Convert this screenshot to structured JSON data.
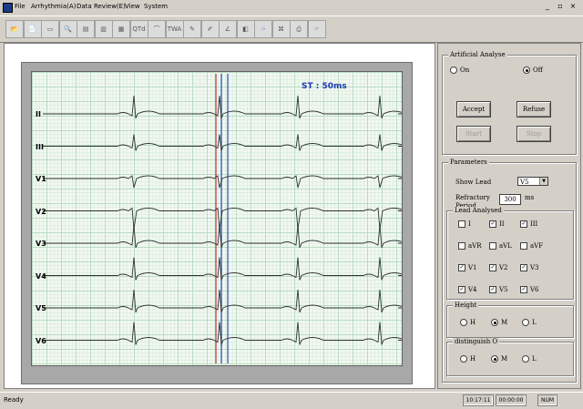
{
  "menu": [
    "File",
    "Arrhythmia(A)",
    "Data Review(E)",
    "View",
    "System"
  ],
  "window_buttons": [
    "_",
    "▫",
    "×"
  ],
  "toolbar": {
    "buttons": [
      {
        "name": "open-file",
        "icon": "📂"
      },
      {
        "name": "new-doc",
        "icon": "📄"
      },
      {
        "name": "print-preview",
        "icon": "▭"
      },
      {
        "name": "zoom",
        "icon": "🔍"
      },
      {
        "name": "report",
        "icon": "▤"
      },
      {
        "name": "histogram",
        "icon": "▥"
      },
      {
        "name": "bar-chart",
        "icon": "▦"
      },
      {
        "name": "qtd",
        "icon": "QTd"
      },
      {
        "name": "pulse",
        "icon": "⌒"
      },
      {
        "name": "twa",
        "icon": "TWA"
      },
      {
        "name": "tool-a",
        "icon": "✎"
      },
      {
        "name": "tool-b",
        "icon": "✐"
      },
      {
        "name": "tool-c",
        "icon": "∠"
      },
      {
        "name": "tool-d",
        "icon": "◧"
      },
      {
        "name": "dots",
        "icon": "⁘"
      },
      {
        "name": "tool-e",
        "icon": "⌘"
      },
      {
        "name": "tool-f",
        "icon": "⎙"
      },
      {
        "name": "tool-g",
        "icon": "☞"
      }
    ]
  },
  "ecg": {
    "st_label": "ST : 50ms",
    "leads": [
      "II",
      "III",
      "V1",
      "V2",
      "V3",
      "V4",
      "V5",
      "V6"
    ]
  },
  "artificial": {
    "title": "Artificial Analyse",
    "on": "On",
    "off": "Off",
    "selected": "Off",
    "accept": "Accept",
    "refuse": "Refuse",
    "start": "Start",
    "stop": "Stop"
  },
  "parameters": {
    "title": "Parameters",
    "show_lead_label": "Show Lead",
    "show_lead_value": "V5",
    "refractory_label1": "Refractory",
    "refractory_label2": "Period",
    "refractory_value": "300",
    "refractory_unit": "ms",
    "lead_group_title": "Lead Analysed",
    "leads": [
      {
        "label": "I",
        "checked": false
      },
      {
        "label": "II",
        "checked": true
      },
      {
        "label": "III",
        "checked": true
      },
      {
        "label": "aVR",
        "checked": false
      },
      {
        "label": "aVL",
        "checked": false
      },
      {
        "label": "aVF",
        "checked": false
      },
      {
        "label": "V1",
        "checked": true
      },
      {
        "label": "V2",
        "checked": true
      },
      {
        "label": "V3",
        "checked": true
      },
      {
        "label": "V4",
        "checked": true
      },
      {
        "label": "V5",
        "checked": true
      },
      {
        "label": "V6",
        "checked": true
      }
    ],
    "height": {
      "title": "Height",
      "options": [
        "H",
        "M",
        "L"
      ],
      "selected": "M"
    },
    "distinguish": {
      "title": "distinguish O",
      "options": [
        "H",
        "M",
        "L"
      ],
      "selected": "M"
    }
  },
  "status": {
    "text": "Ready",
    "time": "10:17:11",
    "duration": "00:00:00",
    "num": "NUM"
  }
}
